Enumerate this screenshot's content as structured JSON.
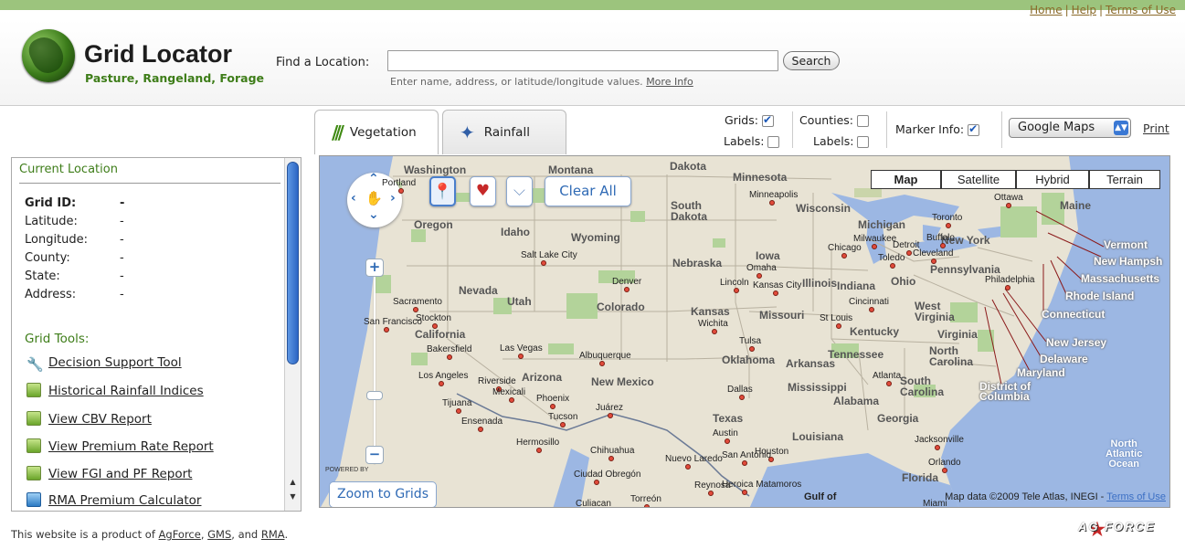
{
  "top_links": {
    "home": "Home",
    "help": "Help",
    "terms": "Terms of Use",
    "sep": "|"
  },
  "logo": {
    "title": "Grid Locator",
    "subtitle": "Pasture, Rangeland, Forage",
    "icon": "globe-icon"
  },
  "search": {
    "label": "Find a Location:",
    "value": "",
    "placeholder": "",
    "button": "Search",
    "hint": "Enter name, address, or latitude/longitude values.",
    "hint_link": "More Info"
  },
  "tabs": [
    {
      "label": "Vegetation",
      "icon": "vegetation-icon",
      "active": true
    },
    {
      "label": "Rainfall",
      "icon": "rainfall-icon",
      "active": false
    }
  ],
  "controls": {
    "grids": "Grids:",
    "grids_checked": true,
    "counties": "Counties:",
    "counties_checked": false,
    "labels": "Labels:",
    "grid_labels_checked": false,
    "county_labels_checked": false,
    "marker_info": "Marker Info:",
    "marker_info_checked": true,
    "map_provider": "Google Maps",
    "print": "Print"
  },
  "location_panel": {
    "title": "Current Location",
    "fields": [
      {
        "label": "Grid ID:",
        "value": "-"
      },
      {
        "label": "Latitude:",
        "value": "-"
      },
      {
        "label": "Longitude:",
        "value": "-"
      },
      {
        "label": "County:",
        "value": "-"
      },
      {
        "label": "State:",
        "value": "-"
      },
      {
        "label": "Address:",
        "value": "-"
      }
    ],
    "tools_title": "Grid Tools:",
    "tools": [
      {
        "label": "Decision Support Tool",
        "icon": "wrench-icon"
      },
      {
        "label": "Historical Rainfall Indices",
        "icon": "report-icon"
      },
      {
        "label": "View CBV Report",
        "icon": "report-icon"
      },
      {
        "label": "View Premium Rate Report",
        "icon": "report-icon"
      },
      {
        "label": "View FGI and PF Report",
        "icon": "report-icon"
      },
      {
        "label": "RMA Premium Calculator",
        "icon": "calculator-icon"
      }
    ]
  },
  "map": {
    "types": [
      "Map",
      "Satellite",
      "Hybrid",
      "Terrain"
    ],
    "active_type": "Map",
    "clear_all": "Clear All",
    "zoom_to_grids": "Zoom to Grids",
    "powered_by": "POWERED BY",
    "copyright": "Map data ©2009 Tele Atlas, INEGI -",
    "copyright_link": "Terms of Use",
    "states": [
      "Washington",
      "Oregon",
      "Idaho",
      "Montana",
      "Wyoming",
      "Nevada",
      "California",
      "Utah",
      "Colorado",
      "Arizona",
      "New Mexico",
      "Dakota",
      "South Dakota",
      "Minnesota",
      "Wisconsin",
      "Michigan",
      "Iowa",
      "Nebraska",
      "Kansas",
      "Missouri",
      "Illinois",
      "Indiana",
      "Ohio",
      "Oklahoma",
      "Arkansas",
      "Texas",
      "Louisiana",
      "Mississippi",
      "Alabama",
      "Georgia",
      "Tennessee",
      "Kentucky",
      "West Virginia",
      "Virginia",
      "North Carolina",
      "South Carolina",
      "Florida",
      "Pennsylvania",
      "New York",
      "Maine"
    ],
    "callouts": [
      "Vermont",
      "New Hampsh",
      "Massachusetts",
      "Rhode Island",
      "Connecticut",
      "New Jersey",
      "Delaware",
      "Maryland",
      "District of Columbia"
    ],
    "oceans": [
      "North Atlantic Ocean",
      "Gulf of"
    ],
    "cities": [
      "Portland",
      "Minneapolis",
      "Ottawa",
      "Toronto",
      "Milwaukee",
      "Chicago",
      "Detroit",
      "Buffalo",
      "Cleveland",
      "Toledo",
      "Salt Lake City",
      "Omaha",
      "Denver",
      "Lincoln",
      "Kansas City",
      "Philadelphia",
      "Sacramento",
      "Stockton",
      "San Francisco",
      "Cincinnati",
      "Wichita",
      "St Louis",
      "Tulsa",
      "Bakersfield",
      "Las Vegas",
      "Albuquerque",
      "Los Angeles",
      "Riverside",
      "Mexicali",
      "Phoenix",
      "Tijuana",
      "Ensenada",
      "Tucson",
      "Juárez",
      "Dallas",
      "Atlanta",
      "Austin",
      "Houston",
      "San Antonio",
      "Hermosillo",
      "Chihuahua",
      "Nuevo Laredo",
      "Jacksonville",
      "Orlando",
      "Ciudad Obregón",
      "Reynosa",
      "Heroica Matamoros",
      "Culiacan",
      "Torreón",
      "Miami"
    ]
  },
  "footer": {
    "text": "This website is a product of",
    "links": [
      "AgForce",
      "GMS",
      "RMA"
    ],
    "and": "and",
    "logo": "AG FORCE"
  }
}
